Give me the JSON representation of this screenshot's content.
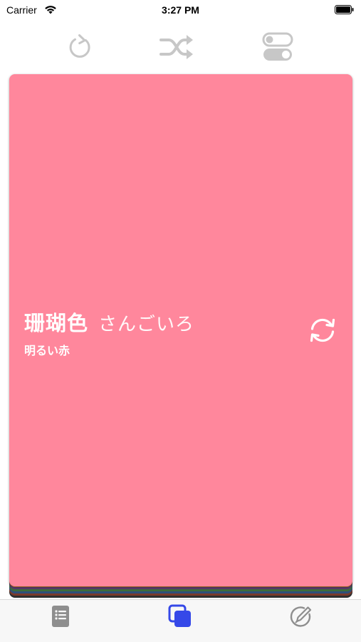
{
  "status_bar": {
    "carrier": "Carrier",
    "time": "3:27 PM"
  },
  "toolbar": {
    "icons": [
      "reload-icon",
      "shuffle-icon",
      "toggle-settings-icon"
    ],
    "icon_color": "#c7c7c7"
  },
  "card": {
    "name_kanji": "珊瑚色",
    "name_reading": "さんごいろ",
    "description": "明るい赤",
    "color": "#ff879c",
    "stack_layer_colors": [
      "#2f2f2f",
      "#7a3a2a",
      "#2d4f7a",
      "#3d6b3a",
      "#5a3a6b",
      "#b87a2a",
      "#444444"
    ]
  },
  "tab_bar": {
    "tabs": [
      {
        "icon": "list-icon",
        "selected": false
      },
      {
        "icon": "cards-icon",
        "selected": true
      },
      {
        "icon": "edit-icon",
        "selected": false
      }
    ],
    "selected_color": "#3548e8",
    "unselected_color": "#8e8e8e"
  }
}
